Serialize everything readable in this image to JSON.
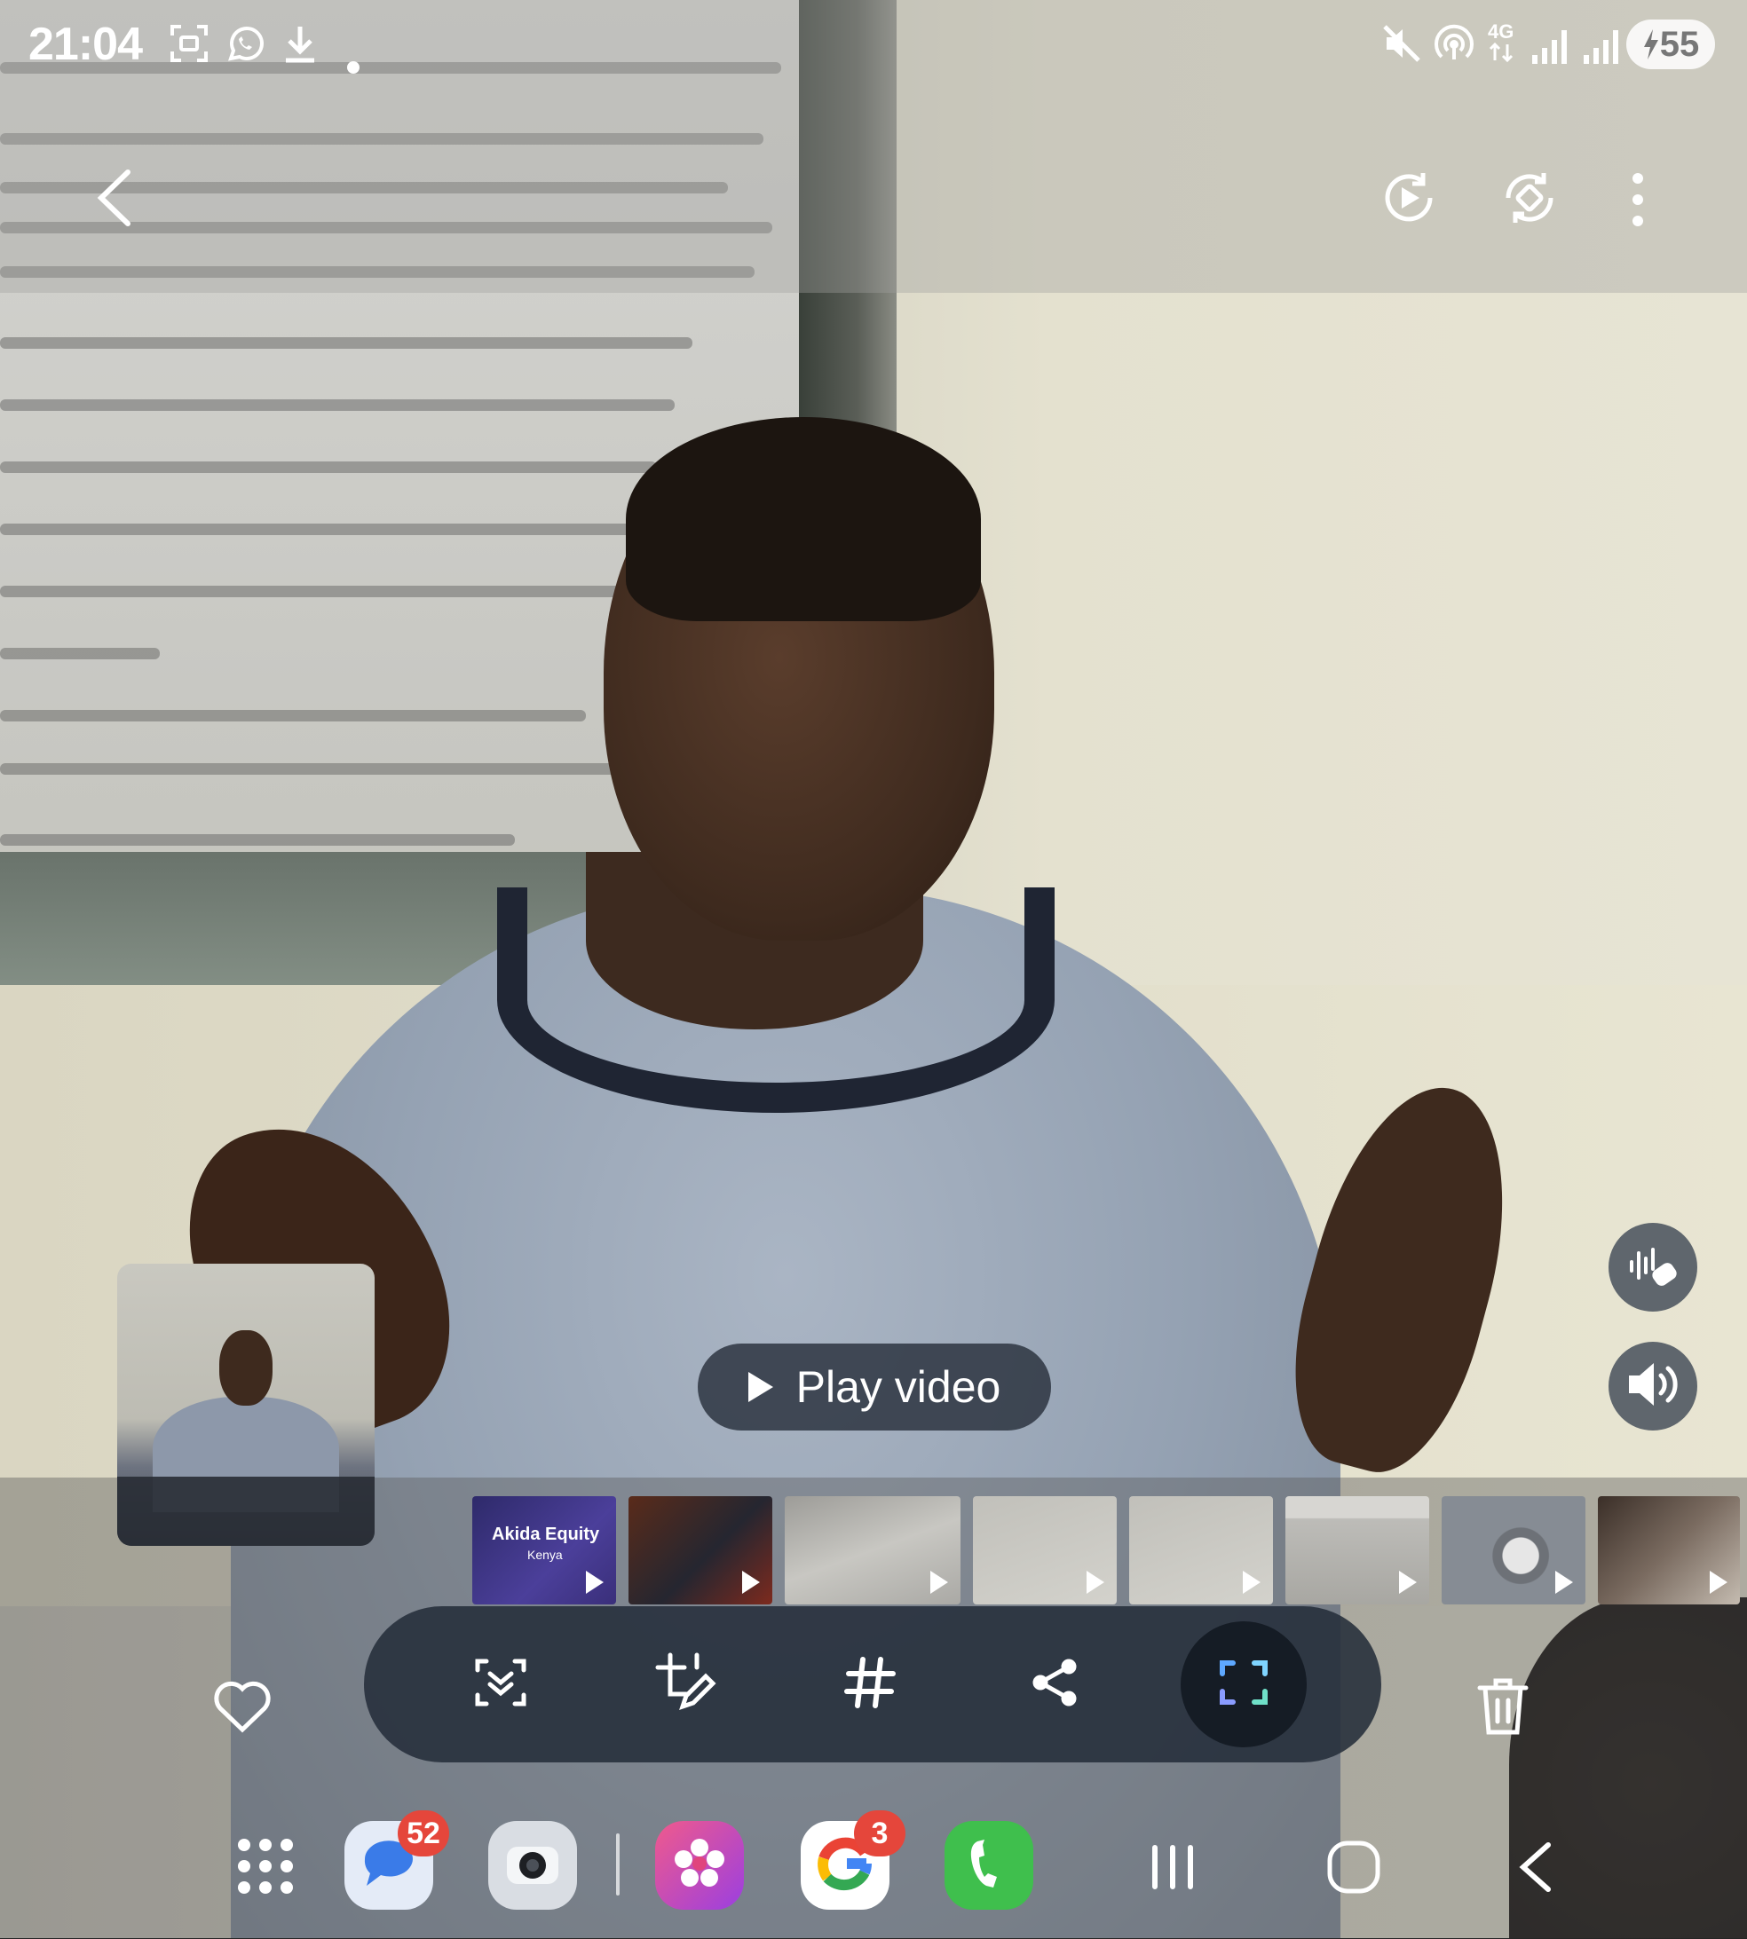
{
  "status_bar": {
    "time": "21:04",
    "left_icons": [
      "screenshot-icon",
      "whatsapp-icon",
      "download-icon",
      "dot-icon"
    ],
    "right_icons": [
      "mute-icon",
      "hotspot-icon",
      "network-4g-icon",
      "signal-icon",
      "signal-icon"
    ],
    "network_label": "4G",
    "battery_level": "55"
  },
  "top_actions": {
    "icons": [
      "back-icon",
      "auto-play-icon",
      "rotate-icon",
      "more-icon"
    ]
  },
  "side_actions": {
    "icons": [
      "audio-eraser-icon",
      "volume-icon"
    ]
  },
  "player": {
    "play_label": "Play video"
  },
  "filmstrip": {
    "items": [
      {
        "title": "Akida Equity",
        "subtitle": "Kenya",
        "type": "video"
      },
      {
        "title": "",
        "subtitle": "",
        "type": "video"
      },
      {
        "title": "",
        "subtitle": "",
        "type": "video"
      },
      {
        "title": "",
        "subtitle": "",
        "type": "video"
      },
      {
        "title": "",
        "subtitle": "",
        "type": "video"
      },
      {
        "title": "",
        "subtitle": "",
        "type": "video"
      },
      {
        "title": "",
        "subtitle": "",
        "type": "video"
      },
      {
        "title": "",
        "subtitle": "",
        "type": "video"
      }
    ]
  },
  "bottom_toolbar": {
    "items": [
      "select-icon",
      "edit-icon",
      "hashtag-icon",
      "share-icon",
      "scan-icon"
    ],
    "left": "heart-icon",
    "right": "delete-icon"
  },
  "dock": {
    "apps": [
      {
        "name": "messages-icon",
        "badge": "52",
        "color": "#3a7be8"
      },
      {
        "name": "camera-icon",
        "badge": "",
        "color": "#d9dde3"
      },
      {
        "name": "gallery-icon",
        "badge": "",
        "color": "#e13a8a"
      },
      {
        "name": "google-icon",
        "badge": "3",
        "color": "#ffffff"
      },
      {
        "name": "phone-icon",
        "badge": "",
        "color": "#3fbf4d"
      }
    ]
  },
  "nav_bar": {
    "icons": [
      "recents-icon",
      "home-icon",
      "nav-back-icon"
    ]
  }
}
